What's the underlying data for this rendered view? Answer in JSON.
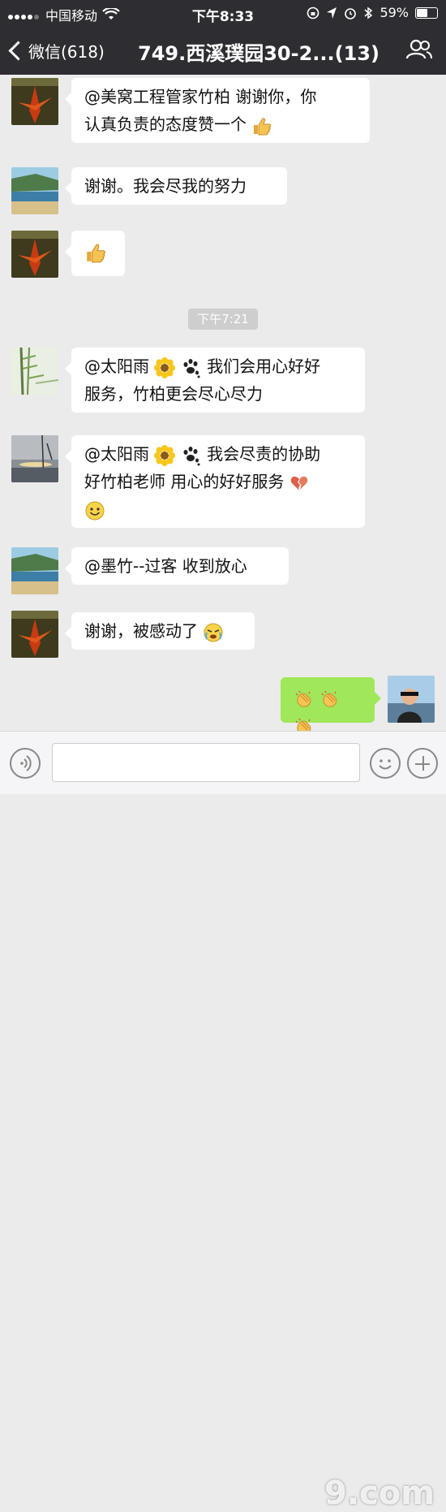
{
  "status_bar": {
    "carrier": "中国移动",
    "time": "下午8:33",
    "battery_percent": "59%",
    "battery_level": 0.59
  },
  "nav": {
    "back_label": "微信(618)",
    "title": "749.西溪璞园30-2...(13)"
  },
  "time_divider": "下午7:21",
  "messages": [
    {
      "text_line1": "@美窝工程管家竹柏 谢谢你，你",
      "text_line2": "认真负责的态度赞一个",
      "emoji_end": "thumbs-up"
    },
    {
      "text": "谢谢。我会尽我的努力"
    },
    {
      "emoji": "thumbs-up"
    },
    {
      "prefix": "@太阳雨",
      "line1_rest": "我们会用心好好",
      "line2": "服务，竹柏更会尽心尽力"
    },
    {
      "prefix": "@太阳雨",
      "line1_rest": "我会尽责的协助",
      "line2": "好竹柏老师 用心的好好服务"
    },
    {
      "text": "@墨竹--过客 收到放心"
    },
    {
      "text": "谢谢，被感动了"
    },
    {
      "emoji": "clapping-x3"
    }
  ],
  "watermark": "9.com",
  "colors": {
    "nav_bg": "#2e2e32",
    "chat_bg": "#ebebeb",
    "my_bubble": "#a0e75a",
    "other_bubble": "#ffffff"
  }
}
